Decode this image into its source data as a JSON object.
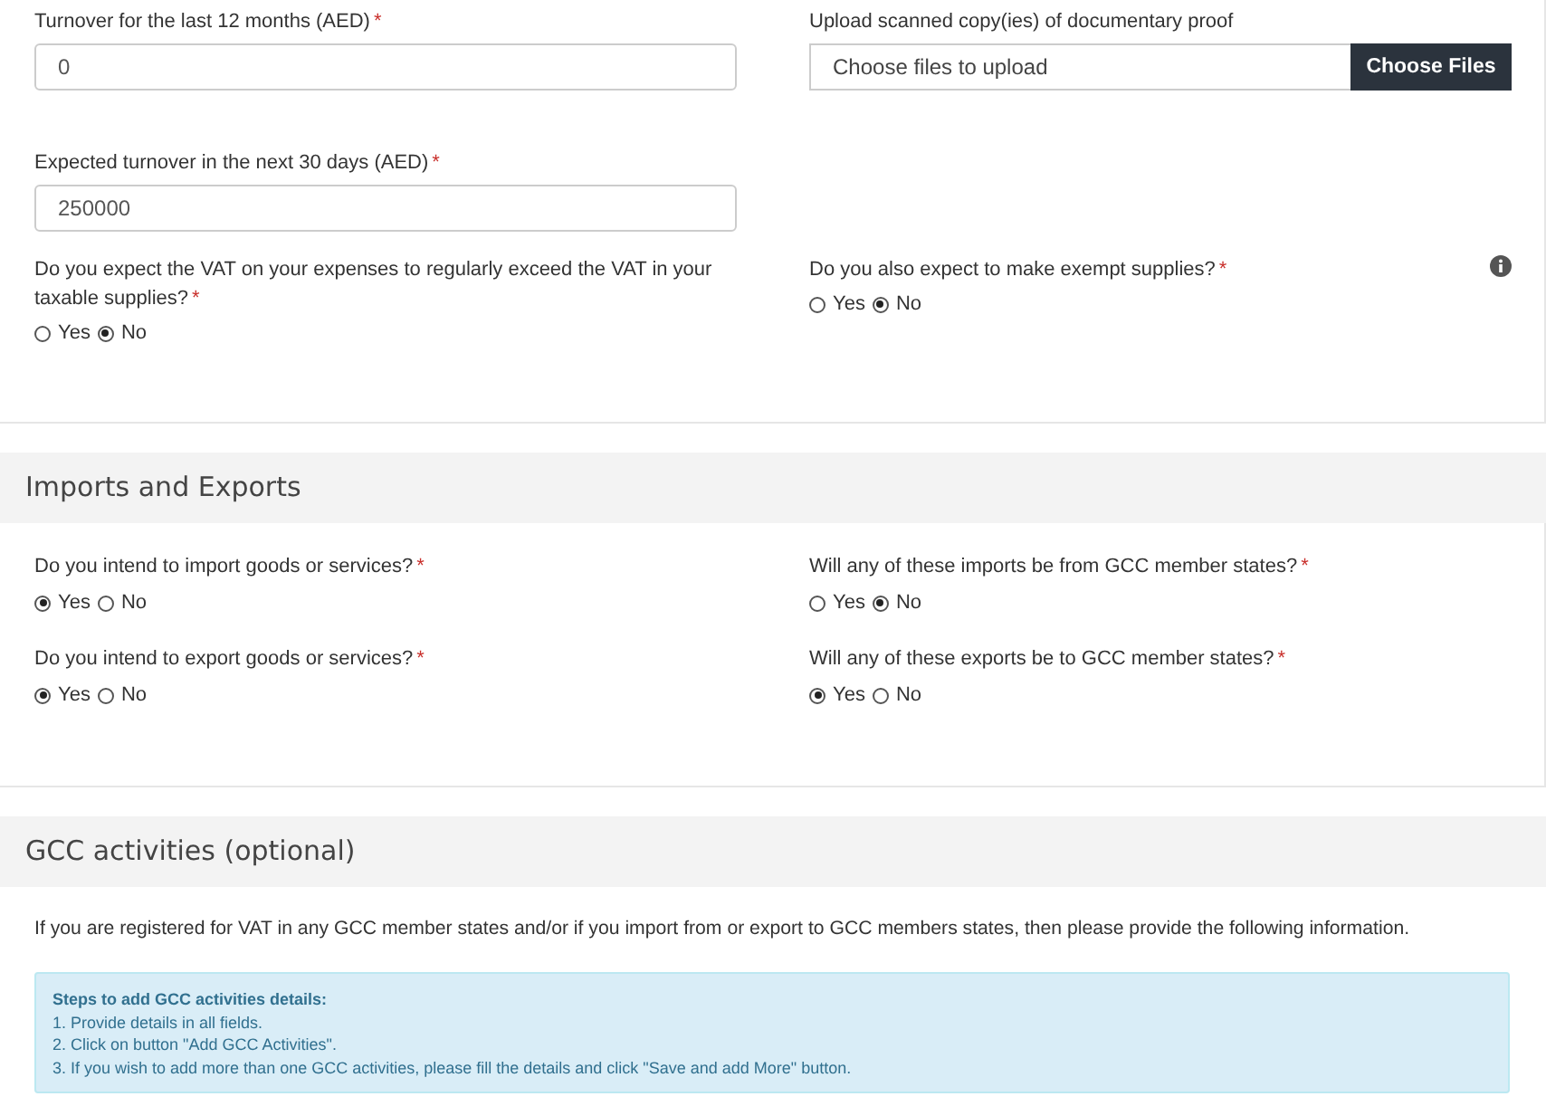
{
  "vat_details": {
    "turnover_last_12_months": {
      "label": "Turnover for the last 12 months (AED)",
      "required_mark": "*",
      "value": "0"
    },
    "upload": {
      "label": "Upload scanned copy(ies) of documentary proof",
      "placeholder": "Choose files to upload",
      "button": "Choose Files"
    },
    "expected_turnover": {
      "label": "Expected turnover in the next 30 days (AED)",
      "required_mark": "*",
      "value": "250000"
    },
    "questions": [
      {
        "label": "Do you expect the VAT on your expenses to regularly exceed the VAT in your taxable supplies?",
        "required_mark": "*",
        "info": false,
        "options": [
          {
            "label": "Yes",
            "selected": false
          },
          {
            "label": "No",
            "selected": true
          }
        ]
      },
      {
        "label": "Do you also expect to make exempt supplies?",
        "required_mark": "*",
        "info": true,
        "options": [
          {
            "label": "Yes",
            "selected": false
          },
          {
            "label": "No",
            "selected": true
          }
        ]
      }
    ]
  },
  "imports_exports": {
    "title": "Imports and Exports",
    "questions": [
      {
        "label": "Do you intend to import goods or services?",
        "required_mark": "*",
        "options": [
          {
            "label": "Yes",
            "selected": true
          },
          {
            "label": "No",
            "selected": false
          }
        ]
      },
      {
        "label": "Will any of these imports be from GCC member states?",
        "required_mark": "*",
        "options": [
          {
            "label": "Yes",
            "selected": false
          },
          {
            "label": "No",
            "selected": true
          }
        ]
      },
      {
        "label": "Do you intend to export goods or services?",
        "required_mark": "*",
        "options": [
          {
            "label": "Yes",
            "selected": true
          },
          {
            "label": "No",
            "selected": false
          }
        ]
      },
      {
        "label": "Will any of these exports be to GCC member states?",
        "required_mark": "*",
        "options": [
          {
            "label": "Yes",
            "selected": true
          },
          {
            "label": "No",
            "selected": false
          }
        ]
      }
    ]
  },
  "gcc_activities": {
    "title": "GCC activities (optional)",
    "intro": "If you are registered for VAT in any GCC member states and/or if you import from or export to GCC members states, then please provide the following information.",
    "steps": {
      "title": "Steps to add GCC activities details:",
      "items": [
        "1. Provide details in all fields.",
        "2. Click on button \"Add GCC Activities\".",
        "3. If you wish to add more than one GCC activities, please fill the details and click \"Save and add More\" button."
      ]
    }
  }
}
